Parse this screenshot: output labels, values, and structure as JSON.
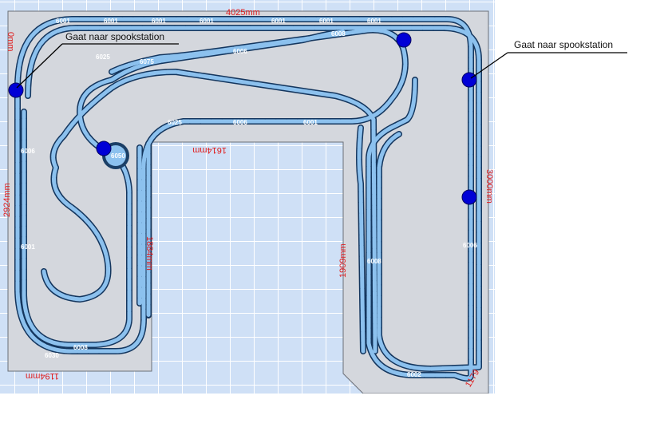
{
  "dimensions": {
    "top": "4025mm",
    "left": "2924mm",
    "right": "3000mm",
    "inner_top": "1614mm",
    "inner_left": "1884mm",
    "inner_right": "1909mm",
    "bottom_left": "1194mm",
    "top_left_corner": "0mm",
    "bottom_right": "1179"
  },
  "callouts": {
    "left": "Gaat naar spookstation",
    "right": "Gaat naar spookstation"
  },
  "track_codes": [
    "6001",
    "6006",
    "6008",
    "6025",
    "6030",
    "6050",
    "6002",
    "6075"
  ],
  "colors": {
    "baseboard": "#d4d7dd",
    "track_fill": "#8cc1ee",
    "track_edge": "#14365e",
    "marker": "#0000d6",
    "dimension": "#e01b1b"
  }
}
